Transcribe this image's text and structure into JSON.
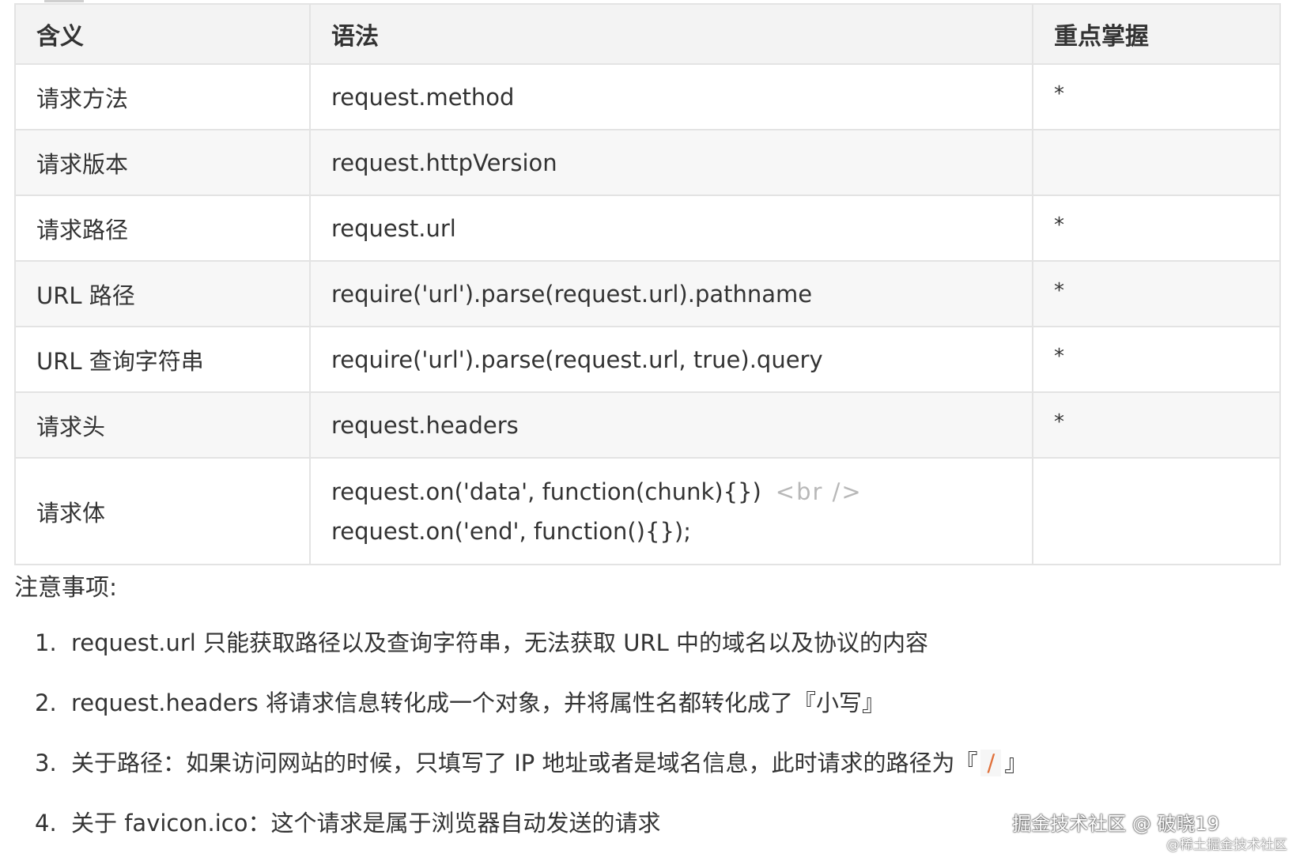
{
  "table": {
    "headers": [
      "含义",
      "语法",
      "重点掌握"
    ],
    "rows": [
      {
        "meaning": "请求方法",
        "syntax": "request.method",
        "key": "*"
      },
      {
        "meaning": "请求版本",
        "syntax": "request.httpVersion",
        "key": ""
      },
      {
        "meaning": "请求路径",
        "syntax": "request.url",
        "key": "*"
      },
      {
        "meaning": "URL 路径",
        "syntax": "require('url').parse(request.url).pathname",
        "key": "*"
      },
      {
        "meaning": "URL 查询字符串",
        "syntax": "require('url').parse(request.url, true).query",
        "key": "*"
      },
      {
        "meaning": "请求头",
        "syntax": "request.headers",
        "key": "*"
      },
      {
        "meaning": "请求体",
        "syntax_line1": "request.on('data', function(chunk){})",
        "br_tag": "<br />",
        "syntax_line2": "request.on('end', function(){});",
        "key": ""
      }
    ]
  },
  "notes": {
    "title": "注意事项:",
    "items": [
      {
        "num": "1.",
        "text": "request.url 只能获取路径以及查询字符串，无法获取 URL 中的域名以及协议的内容"
      },
      {
        "num": "2.",
        "text": "request.headers 将请求信息转化成一个对象，并将属性名都转化成了『小写』"
      },
      {
        "num": "3.",
        "text_before": "关于路径：如果访问网站的时候，只填写了 IP 地址或者是域名信息，此时请求的路径为『",
        "slash": "/",
        "text_after": "』"
      },
      {
        "num": "4.",
        "text": "关于 favicon.ico：这个请求是属于浏览器自动发送的请求"
      }
    ]
  },
  "watermark": {
    "main": "掘金技术社区 @ 破晓19",
    "small": "@稀土掘金技术社区"
  }
}
